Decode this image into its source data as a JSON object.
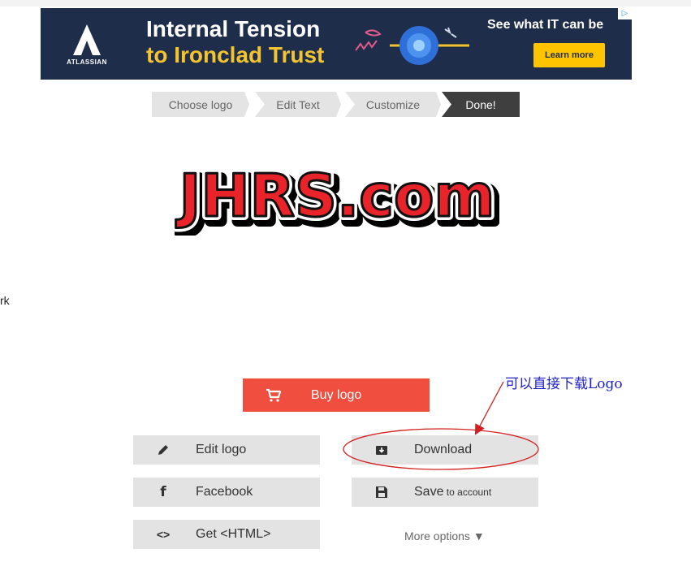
{
  "ad": {
    "brand": "ATLASSIAN",
    "headline1": "Internal Tension",
    "headline2": "to Ironclad Trust",
    "tagline": "See what IT can be",
    "cta": "Learn more",
    "badge": "▷"
  },
  "steps": [
    {
      "label": "Choose logo",
      "state": "completed"
    },
    {
      "label": "Edit Text",
      "state": "completed"
    },
    {
      "label": "Customize",
      "state": "completed"
    },
    {
      "label": "Done!",
      "state": "active"
    }
  ],
  "logo_text": "JHRS.com",
  "side_fragment": "rk",
  "annotation": {
    "note": "可以直接下载Logo"
  },
  "actions": {
    "buy": "Buy logo",
    "edit": "Edit logo",
    "download": "Download",
    "facebook": "Facebook",
    "save": "Save",
    "save_suffix": " to account",
    "html": "Get <HTML>",
    "more": "More options ▼"
  },
  "colors": {
    "ad_bg": "#1e2d4a",
    "ad_accent": "#f4c430",
    "buy": "#f04e3e",
    "step_active": "#3f3f3f",
    "logo_red": "#e8232a",
    "annotation_red": "#d42020",
    "annotation_blue": "#2222cc"
  },
  "icons": {
    "buy": "cart-icon",
    "edit": "pencil-icon",
    "download": "download-box-icon",
    "facebook": "facebook-icon",
    "save": "floppy-disk-icon",
    "html": "code-icon"
  }
}
